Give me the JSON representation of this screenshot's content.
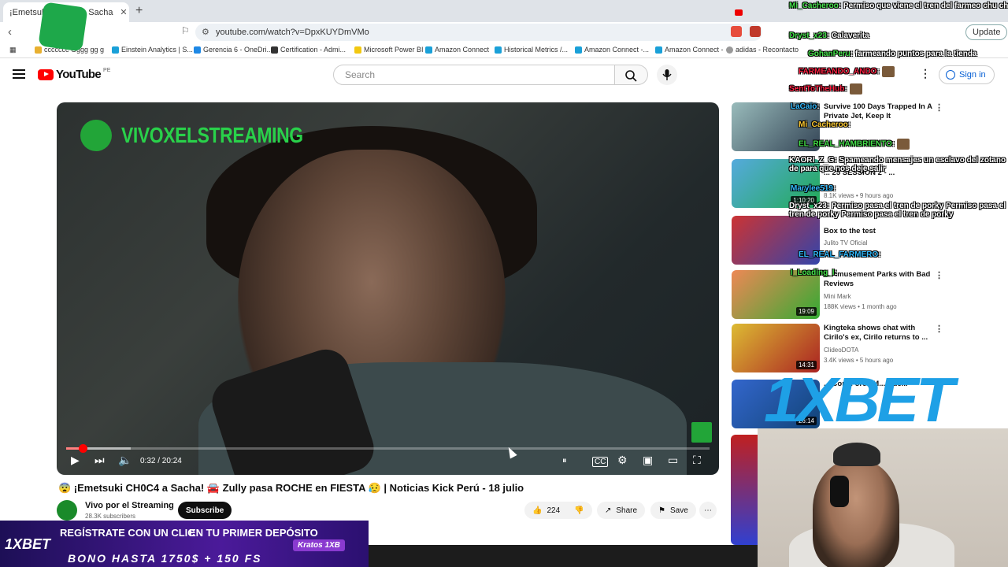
{
  "browser": {
    "tab_title": "¡Emetsuki CH0C4 a Sacha",
    "url": "youtube.com/watch?v=DpxKUYDmVMo",
    "update_label": "Update",
    "bookmarks": [
      "ccccccc Gggg gg g",
      "Einstein Analytics | S...",
      "Gerencia 6 - OneDri...",
      "Certification - Admi...",
      "Microsoft Power BI",
      "Amazon Connect",
      "Historical Metrics /...",
      "Amazon Connect -...",
      "Amazon Connect -",
      "adidas - Recontacto"
    ]
  },
  "header": {
    "logo_text": "YouTube",
    "region": "PE",
    "search_placeholder": "Search",
    "signin_label": "Sign in"
  },
  "player": {
    "channel_watermark": "VIVOXELSTREAMING",
    "time": "0:32 / 20:24",
    "progress_fraction": 0.026
  },
  "video": {
    "title": "😨 ¡Emetsuki CH0C4 a Sacha! 🚘 Zully pasa ROCHE en FIESTA 😥 | Noticias Kick Perú - 18 julio",
    "channel": "Vivo por el Streaming",
    "subscribers": "28.3K subscribers",
    "subscribe_label": "Subscribe",
    "likes": "224",
    "share_label": "Share",
    "save_label": "Save"
  },
  "recommendations": [
    {
      "title": "Survive 100 Days Trapped In A Private Jet, Keep It",
      "channel": "",
      "meta": "",
      "duration": ""
    },
    {
      "title": "... 25 SESSION 2 - ...",
      "channel": "",
      "meta": "8.1K views • 9 hours ago",
      "duration": "1:10:20"
    },
    {
      "title": "Box to the test",
      "channel": "Julito TV Oficial",
      "meta": "",
      "duration": ""
    },
    {
      "title": "... Amusement Parks with Bad Reviews",
      "channel": "Mini Mark",
      "meta": "188K views • 1 month ago",
      "duration": "19:09"
    },
    {
      "title": "Kingteka shows chat with Cirilo's ex, Cirilo returns to ...",
      "channel": "ClideoDOTA",
      "meta": "3.4K views • 5 hours ago",
      "duration": "14:31"
    },
    {
      "title": "... Con... ores M... Nue...",
      "channel": "",
      "meta": "",
      "duration": "26:14"
    }
  ],
  "chat": [
    {
      "user": "Mi_Cacheroo",
      "text": ": Permiso que viene el tren del farmeo chu chu"
    },
    {
      "user": "Dryst_x23",
      "text": ": Calaverita"
    },
    {
      "user": "GohanPeru",
      "text": ": farmeando puntos para la tienda"
    },
    {
      "user": "FARMEANDO_ANDO",
      "text": ":"
    },
    {
      "user": "SentToTheHub",
      "text": ":"
    },
    {
      "user": "LaCaio",
      "text": ":"
    },
    {
      "user": "Mi_Cacheroo",
      "text": ":"
    },
    {
      "user": "EL_REAL_HAMBRIENTO",
      "text": ":"
    },
    {
      "user": "KAORI_Z_G",
      "text": ": Spameando mensajes un esclavo del zotano de para que nos deje salir"
    },
    {
      "user": "Marylee519",
      "text": ":"
    },
    {
      "user": "Dryst_x23",
      "text": ": Permiso pasa el tren de porky Permiso pasa el tren de porky Permiso pasa el tren de porky"
    },
    {
      "user": "EL_REAL_FARMERO",
      "text": ":"
    },
    {
      "user": "I_Loading_I",
      "text": ":"
    }
  ],
  "ads": {
    "brand": "1XBET",
    "banner_l1": "REGÍSTRATE CON UN CLIC",
    "banner_l2": "EN TU PRIMER DEPÓSITO",
    "banner_l3": "BONO HASTA 1750$ + 150 FS",
    "banner_tag": "Kratos 1XB"
  },
  "colors": {
    "yt_red": "#ff0000",
    "chat_user": "#44e04a",
    "brand_green": "#29d14a",
    "ad_blue": "#1ea0e6"
  }
}
